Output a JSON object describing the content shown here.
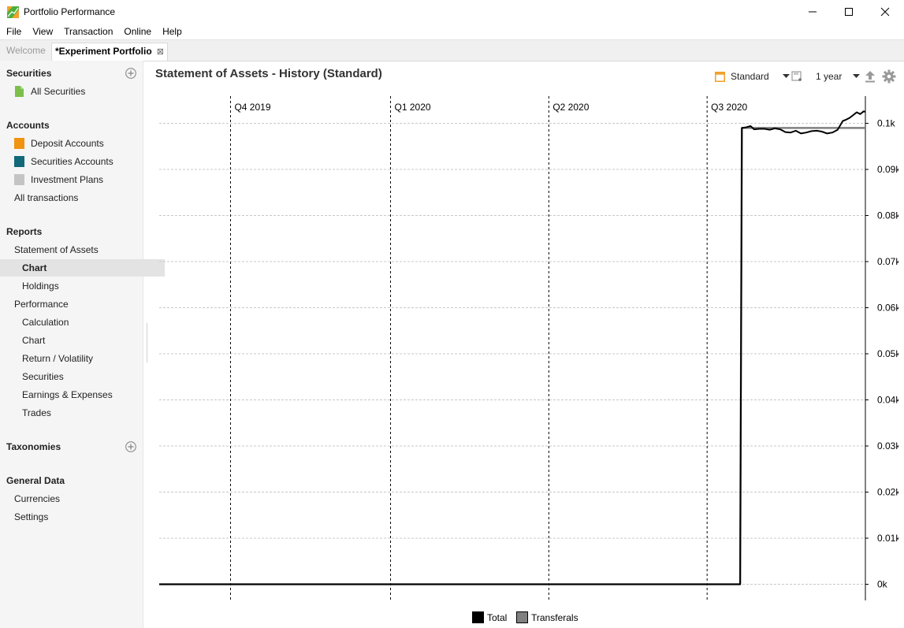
{
  "window": {
    "title": "Portfolio Performance"
  },
  "menu": [
    "File",
    "View",
    "Transaction",
    "Online",
    "Help"
  ],
  "tabs": {
    "welcome": "Welcome",
    "active": "*Experiment Portfolio"
  },
  "sidebar": {
    "securities": {
      "heading": "Securities",
      "items": [
        "All Securities"
      ]
    },
    "accounts": {
      "heading": "Accounts",
      "items": [
        "Deposit Accounts",
        "Securities Accounts",
        "Investment Plans",
        "All transactions"
      ]
    },
    "reports": {
      "heading": "Reports",
      "statement": "Statement of Assets",
      "statement_children": [
        "Chart",
        "Holdings"
      ],
      "performance": "Performance",
      "performance_children": [
        "Calculation",
        "Chart",
        "Return / Volatility",
        "Securities",
        "Earnings & Expenses",
        "Trades"
      ]
    },
    "taxonomies": {
      "heading": "Taxonomies"
    },
    "general": {
      "heading": "General Data",
      "items": [
        "Currencies",
        "Settings"
      ]
    }
  },
  "report": {
    "title": "Statement of Assets - History (Standard)",
    "config_label": "Standard",
    "period_label": "1 year"
  },
  "colors": {
    "total": "#000000",
    "transferals": "#808080",
    "standard_icon": "#f2a12b"
  },
  "chart_data": {
    "type": "line",
    "title": "",
    "x_ticks": [
      "Q4 2019",
      "Q1 2020",
      "Q2 2020",
      "Q3 2020"
    ],
    "y_ticks": [
      "0k",
      "0.01k",
      "0.02k",
      "0.03k",
      "0.04k",
      "0.05k",
      "0.06k",
      "0.07k",
      "0.08k",
      "0.09k",
      "0.1k"
    ],
    "ylim": [
      0,
      103
    ],
    "xlim": [
      "2019-08-21",
      "2020-09-30"
    ],
    "grid": true,
    "legend_position": "bottom",
    "series": [
      {
        "name": "Total",
        "color": "#000000",
        "x": [
          "2019-08-21",
          "2020-07-20",
          "2020-07-21",
          "2020-07-23",
          "2020-07-26",
          "2020-07-28",
          "2020-07-31",
          "2020-08-03",
          "2020-08-06",
          "2020-08-09",
          "2020-08-12",
          "2020-08-15",
          "2020-08-18",
          "2020-08-21",
          "2020-08-24",
          "2020-08-27",
          "2020-08-30",
          "2020-09-02",
          "2020-09-05",
          "2020-09-08",
          "2020-09-11",
          "2020-09-14",
          "2020-09-17",
          "2020-09-19",
          "2020-09-21",
          "2020-09-23",
          "2020-09-25",
          "2020-09-27",
          "2020-09-29",
          "2020-09-30"
        ],
        "values": [
          0,
          0,
          99,
          99.1,
          99.4,
          98.7,
          98.8,
          98.8,
          98.6,
          98.9,
          98.7,
          98.1,
          98.0,
          98.4,
          97.8,
          98.0,
          98.3,
          98.4,
          98.2,
          97.8,
          98.0,
          98.6,
          100.5,
          100.8,
          101.2,
          101.8,
          102.4,
          102.0,
          102.6,
          102.5
        ]
      },
      {
        "name": "Transferals",
        "color": "#808080",
        "x": [
          "2019-08-21",
          "2020-07-20",
          "2020-07-21",
          "2020-09-30"
        ],
        "values": [
          0,
          0,
          99,
          99
        ]
      }
    ]
  }
}
